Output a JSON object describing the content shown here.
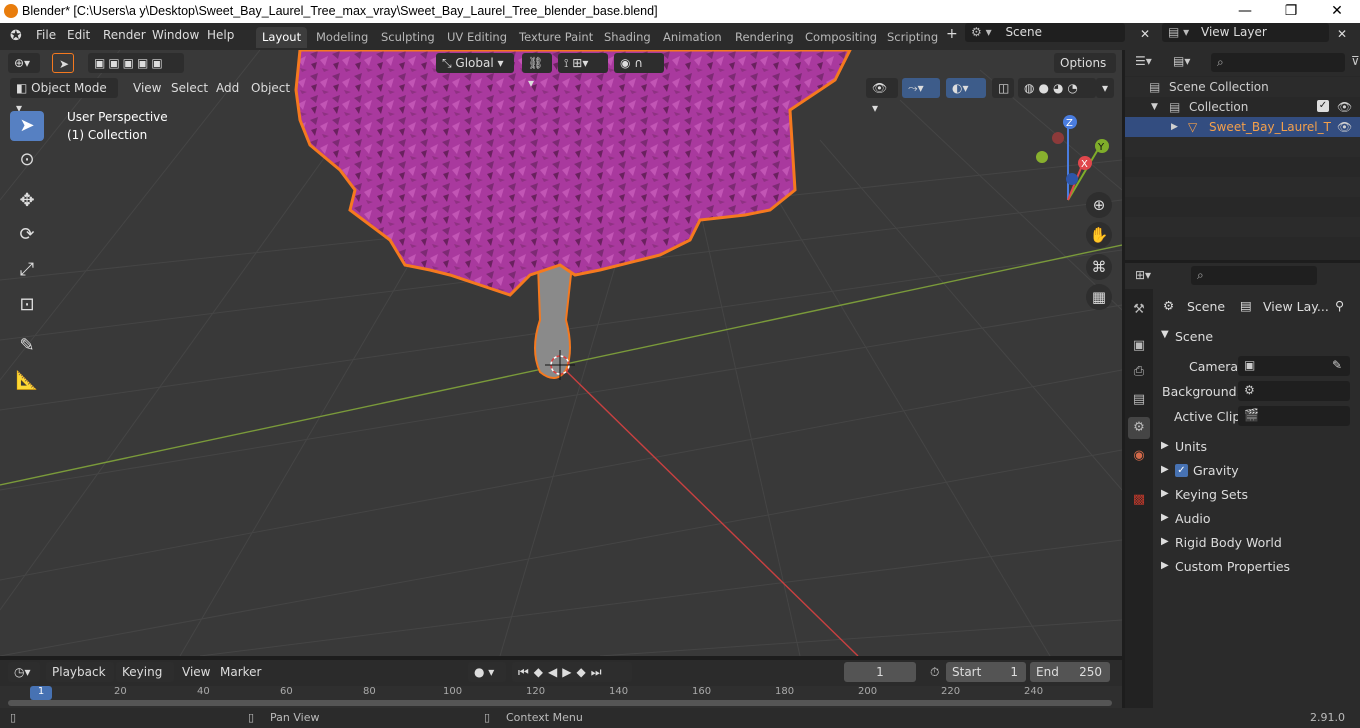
{
  "window": {
    "title": "Blender* [C:\\Users\\a y\\Desktop\\Sweet_Bay_Laurel_Tree_max_vray\\Sweet_Bay_Laurel_Tree_blender_base.blend]",
    "minimize": "—",
    "maximize": "❐",
    "close": "✕"
  },
  "menubar": [
    "File",
    "Edit",
    "Render",
    "Window",
    "Help"
  ],
  "workspaces": [
    "Layout",
    "Modeling",
    "Sculpting",
    "UV Editing",
    "Texture Paint",
    "Shading",
    "Animation",
    "Rendering",
    "Compositing",
    "Scripting"
  ],
  "scene_field": "Scene",
  "view_layer_field": "View Layer",
  "viewport_header": {
    "transform_orientation": "Global",
    "options": "Options",
    "mode": "Object Mode",
    "menus": [
      "View",
      "Select",
      "Add",
      "Object"
    ]
  },
  "viewport_overlay": {
    "perspective": "User Perspective",
    "collection": "(1) Collection"
  },
  "gizmo": {
    "x": "X",
    "y": "Y",
    "z": "Z"
  },
  "outliner": {
    "scene_collection": "Scene Collection",
    "collection": "Collection",
    "object": "Sweet_Bay_Laurel_T"
  },
  "properties": {
    "breadcrumb_scene": "Scene",
    "breadcrumb_view_layer": "View Lay...",
    "panel_title": "Scene",
    "camera_label": "Camera",
    "background_label": "Background...",
    "active_clip_label": "Active Clip",
    "sections": [
      "Units",
      "Gravity",
      "Keying Sets",
      "Audio",
      "Rigid Body World",
      "Custom Properties"
    ],
    "gravity_checked": true
  },
  "timeline": {
    "menus": [
      "Playback",
      "Keying",
      "View",
      "Marker"
    ],
    "current_frame": "1",
    "start_label": "Start",
    "start_value": "1",
    "end_label": "End",
    "end_value": "250",
    "ruler_marks": [
      "1",
      "20",
      "40",
      "60",
      "80",
      "100",
      "120",
      "140",
      "160",
      "180",
      "200",
      "220",
      "240"
    ]
  },
  "statusbar": {
    "pan_view": "Pan View",
    "context_menu": "Context Menu",
    "version": "2.91.0"
  },
  "colors": {
    "accent_blue": "#5680c2",
    "selection_orange": "#f5791f",
    "foliage_magenta": "#a9399e",
    "axis_red": "#c84040",
    "axis_green": "#7a9a3a"
  }
}
